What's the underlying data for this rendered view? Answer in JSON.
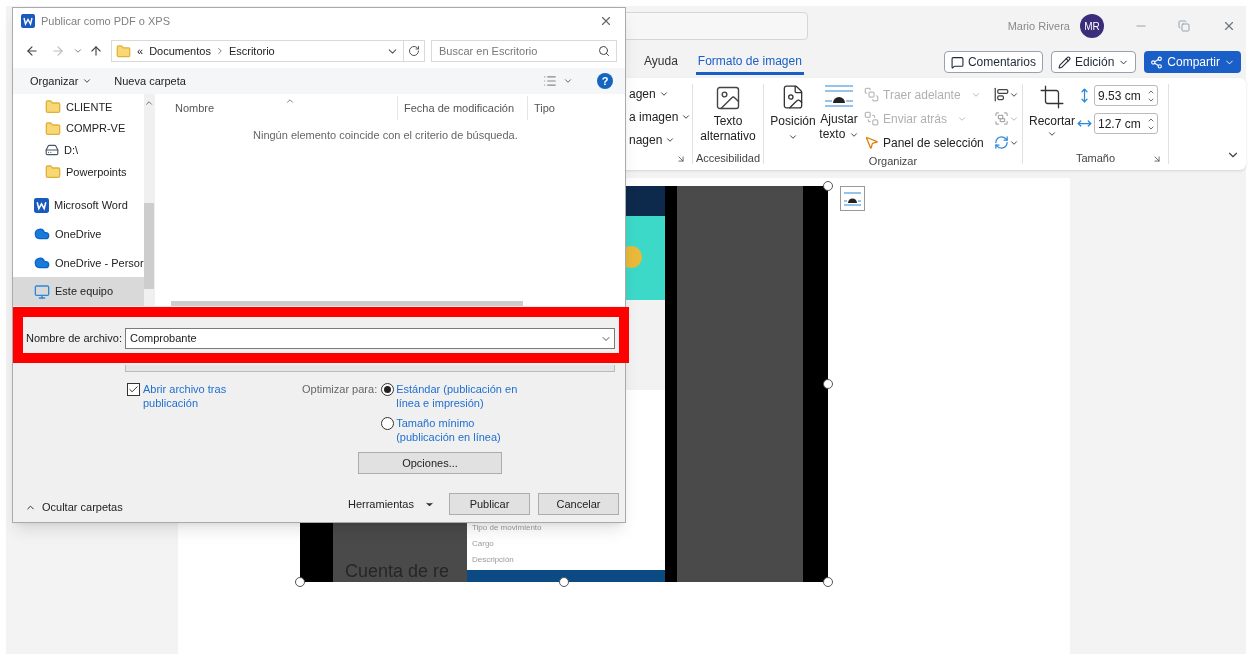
{
  "app": {
    "user_name": "Mario Rivera",
    "user_initials": "MR",
    "tabs": [
      {
        "label": "Ayuda",
        "selected": false
      },
      {
        "label": "Formato de imagen",
        "selected": true
      }
    ],
    "actions": [
      {
        "label": "Comentarios",
        "kind": "comments"
      },
      {
        "label": "Edición",
        "kind": "editing"
      },
      {
        "label": "Compartir",
        "kind": "share"
      }
    ]
  },
  "ribbon": {
    "partial_items": [
      "agen",
      "a imagen",
      "nagen"
    ],
    "accessibility": {
      "button": "Texto alternativo",
      "group": "Accesibilidad"
    },
    "arrange": {
      "group": "Organizar",
      "large": [
        {
          "label": "Posición",
          "kind": "position"
        },
        {
          "label": "Ajustar texto",
          "kind": "wrap"
        }
      ],
      "small": [
        {
          "label": "Traer adelante",
          "disabled": true
        },
        {
          "label": "Enviar atrás",
          "disabled": true
        },
        {
          "label": "Panel de selección",
          "disabled": false
        }
      ]
    },
    "size": {
      "group": "Tamaño",
      "crop": "Recortar",
      "height": "9.53 cm",
      "width": "12.7 cm"
    }
  },
  "document": {
    "picture_title": "Cuenta de re",
    "picture_texts": [
      "Tipo de movimiento",
      "Cargo",
      "Descripción"
    ]
  },
  "dialog": {
    "title": "Publicar como PDF o XPS",
    "path_overflow": "«",
    "path": [
      "Documentos",
      "Escritorio"
    ],
    "search_placeholder": "Buscar en Escritorio",
    "toolbar": [
      "Organizar",
      "Nueva carpeta"
    ],
    "help": "?",
    "nav_items": [
      {
        "label": "CLIENTE",
        "kind": "folder",
        "selected": false
      },
      {
        "label": "COMPR-VE",
        "kind": "folder",
        "selected": false
      },
      {
        "label": "D:\\",
        "kind": "drive",
        "selected": false
      },
      {
        "label": "Powerpoints",
        "kind": "folder",
        "selected": false
      },
      {
        "label": "Microsoft Word",
        "kind": "word",
        "selected": false
      },
      {
        "label": "OneDrive",
        "kind": "cloud",
        "selected": false
      },
      {
        "label": "OneDrive - Persor",
        "kind": "cloud",
        "selected": false
      },
      {
        "label": "Este equipo",
        "kind": "pc",
        "selected": true
      }
    ],
    "columns": [
      "Nombre",
      "Fecha de modificación",
      "Tipo"
    ],
    "empty_message": "Ningún elemento coincide con el criterio de búsqueda.",
    "filename": {
      "label": "Nombre de archivo:",
      "value": "Comprobante"
    },
    "open_after": {
      "label": "Abrir archivo tras publicación",
      "checked": true
    },
    "optimize": {
      "label": "Optimizar para:",
      "options": [
        {
          "label": "Estándar (publicación en línea e impresión)",
          "selected": true
        },
        {
          "label": "Tamaño mínimo (publicación en línea)",
          "selected": false
        }
      ]
    },
    "options_button": "Opciones...",
    "hide_folders": "Ocultar carpetas",
    "tools": "Herramientas",
    "buttons": [
      "Publicar",
      "Cancelar"
    ]
  }
}
